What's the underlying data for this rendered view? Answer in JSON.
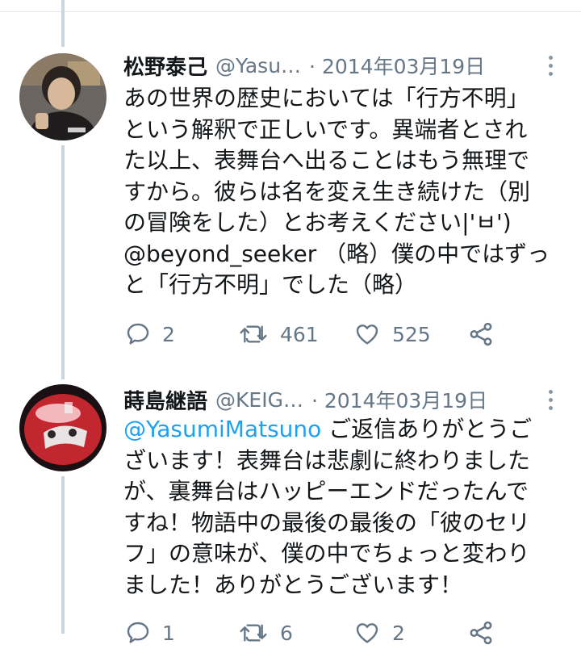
{
  "tweets": [
    {
      "name": "松野泰己",
      "handle": "@Yasu…",
      "date": "· 2014年03月19日",
      "lines": [
        "あの世界の歴史においては「行方不明」",
        "という解釈で正しいです。異端者とされ",
        "た以上、表舞台へ出ることはもう無理で",
        "すから。彼らは名を変え生き続けた（別",
        "の冒険をした）とお考えください|'ㅂ')",
        "@beyond_seeker （略）僕の中ではずっ",
        "と「行方不明」でした（略）"
      ],
      "replies": "2",
      "retweets": "461",
      "likes": "525"
    },
    {
      "name": "蒔島継語",
      "handle": "@KEIG…",
      "date": "· 2014年03月19日",
      "mention": "@YasumiMatsuno",
      "line1_rest": " ご返信ありがとうご",
      "lines": [
        "ざいます！表舞台は悲劇に終わりました",
        "が、裏舞台はハッピーエンドだったんで",
        "すね！物語中の最後の最後の「彼のセリ",
        "フ」の意味が、僕の中でちょっと変わり",
        "ました！ありがとうございます！"
      ],
      "replies": "1",
      "retweets": "6",
      "likes": "2"
    }
  ],
  "colors": {
    "text": "#14171a",
    "secondary": "#657786",
    "accent": "#1da1f2",
    "thread_line": "#ccd6dd"
  },
  "icons": [
    "reply-icon",
    "retweet-icon",
    "like-icon",
    "share-icon",
    "more-options-icon"
  ]
}
